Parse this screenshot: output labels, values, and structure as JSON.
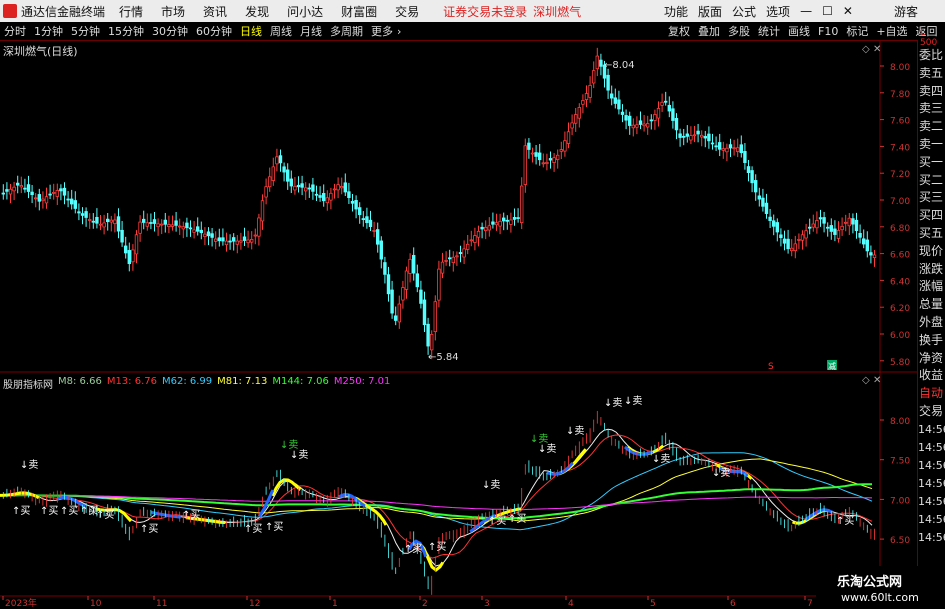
{
  "menubar": {
    "app_name": "通达信金融终端",
    "items": [
      "行情",
      "市场",
      "资讯",
      "发现",
      "问小达",
      "财富圈",
      "交易"
    ],
    "notice": "证券交易未登录",
    "stock": "深圳燃气",
    "right_items": [
      "功能",
      "版面",
      "公式",
      "选项"
    ],
    "guest": "游客"
  },
  "toolbar": {
    "timeframes": [
      "分时",
      "1分钟",
      "5分钟",
      "15分钟",
      "30分钟",
      "60分钟",
      "日线",
      "周线",
      "月线",
      "多周期",
      "更多"
    ],
    "active": "日线",
    "right_buttons": [
      "复权",
      "叠加",
      "多股",
      "统计",
      "画线",
      "F10",
      "标记",
      "+自选",
      "返回"
    ]
  },
  "main_chart": {
    "title": "深圳燃气(日线)",
    "high_label": "8.04",
    "low_label": "5.84",
    "y_ticks": [
      "8.00",
      "7.80",
      "7.60",
      "7.40",
      "7.20",
      "7.00",
      "6.80",
      "6.60",
      "6.40",
      "6.20",
      "6.00",
      "5.80"
    ]
  },
  "indicator": {
    "name": "股朋指标网",
    "ma": [
      {
        "label": "M8: 6.66",
        "color": "#f0f0f0"
      },
      {
        "label": "M13: 6.76",
        "color": "#ff3333"
      },
      {
        "label": "M62: 6.99",
        "color": "#33ccff"
      },
      {
        "label": "M81: 7.13",
        "color": "#ffff33"
      },
      {
        "label": "M144: 7.06",
        "color": "#33ff33"
      },
      {
        "label": "M250: 7.01",
        "color": "#ff33ff"
      }
    ],
    "y_ticks": [
      "8.00",
      "7.50",
      "7.00",
      "6.50"
    ],
    "sell_label": "卖",
    "buy_label": "买",
    "other_label": "减"
  },
  "right_panel": {
    "scale": "500",
    "items": [
      "委比",
      "卖五",
      "卖四",
      "卖三",
      "卖二",
      "卖一",
      "买一",
      "买二",
      "买三",
      "买四",
      "买五",
      "现价",
      "涨跌",
      "涨幅",
      "总量",
      "外盘",
      "换手",
      "净资",
      "收益"
    ],
    "bottom_items": [
      "自动",
      "交易"
    ],
    "time_ticks": [
      "14:56",
      "14:56",
      "14:56",
      "14:56",
      "14:56",
      "14:56",
      "14:56"
    ]
  },
  "x_axis": [
    "2023年",
    "10",
    "11",
    "12",
    "1",
    "2",
    "3",
    "4",
    "5",
    "6",
    "7"
  ],
  "watermark": {
    "title": "乐淘公式网",
    "url": "www.60lt.com"
  }
}
